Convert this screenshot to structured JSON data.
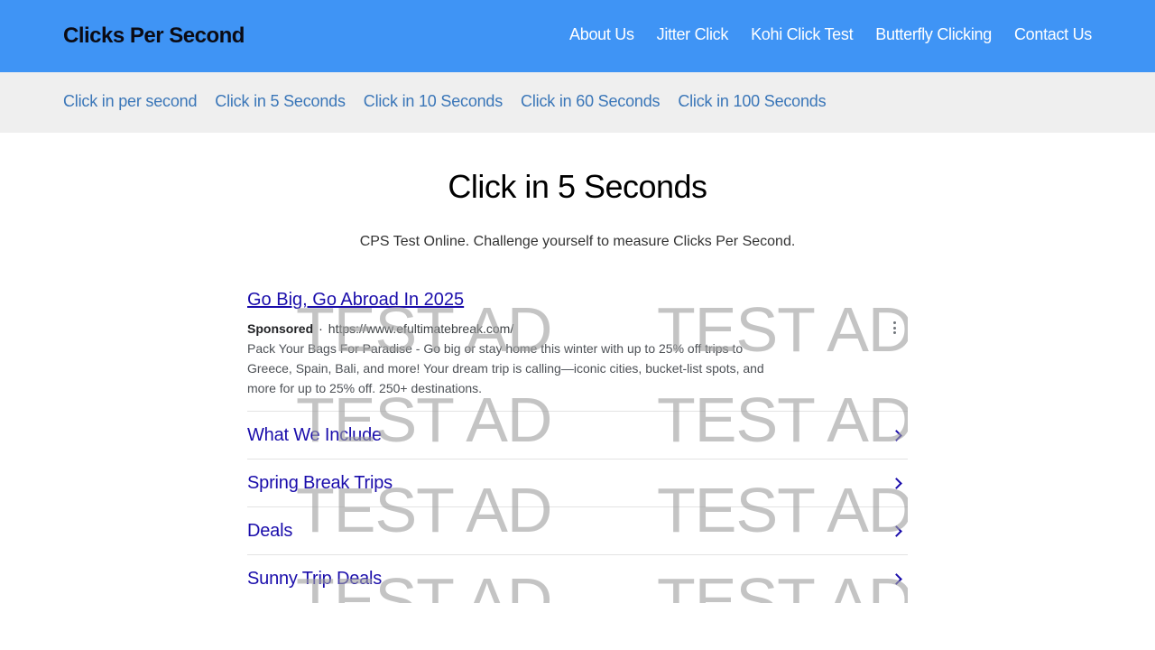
{
  "header": {
    "brand": "Clicks Per Second",
    "nav": [
      "About Us",
      "Jitter Click",
      "Kohi Click Test",
      "Butterfly Clicking",
      "Contact Us"
    ]
  },
  "subnav": [
    "Click in per second",
    "Click in 5 Seconds",
    "Click in 10 Seconds",
    "Click in 60 Seconds",
    "Click in 100 Seconds"
  ],
  "main": {
    "title": "Click in 5 Seconds",
    "subtitle": "CPS Test Online. Challenge yourself to measure Clicks Per Second."
  },
  "ad": {
    "headline": "Go Big, Go Abroad In 2025",
    "sponsored": "Sponsored",
    "separator": "·",
    "url": "https://www.efultimatebreak.com/",
    "description": "Pack Your Bags For Paradise - Go big or stay home this winter with up to 25% off trips to Greece, Spain, Bali, and more! Your dream trip is calling—iconic cities, bucket-list spots, and more for up to 25% off. 250+ destinations.",
    "sitelinks": [
      "What We Include",
      "Spring Break Trips",
      "Deals",
      "Sunny Trip Deals"
    ],
    "watermark": "TEST AD",
    "menu_icon": "kebab-menu-icon",
    "sitelink_icon": "chevron-right-icon"
  },
  "colors": {
    "header_bg": "#3f94f5",
    "subnav_bg": "#efefef",
    "subnav_link": "#3a76b8",
    "ad_link": "#1a0dab"
  }
}
